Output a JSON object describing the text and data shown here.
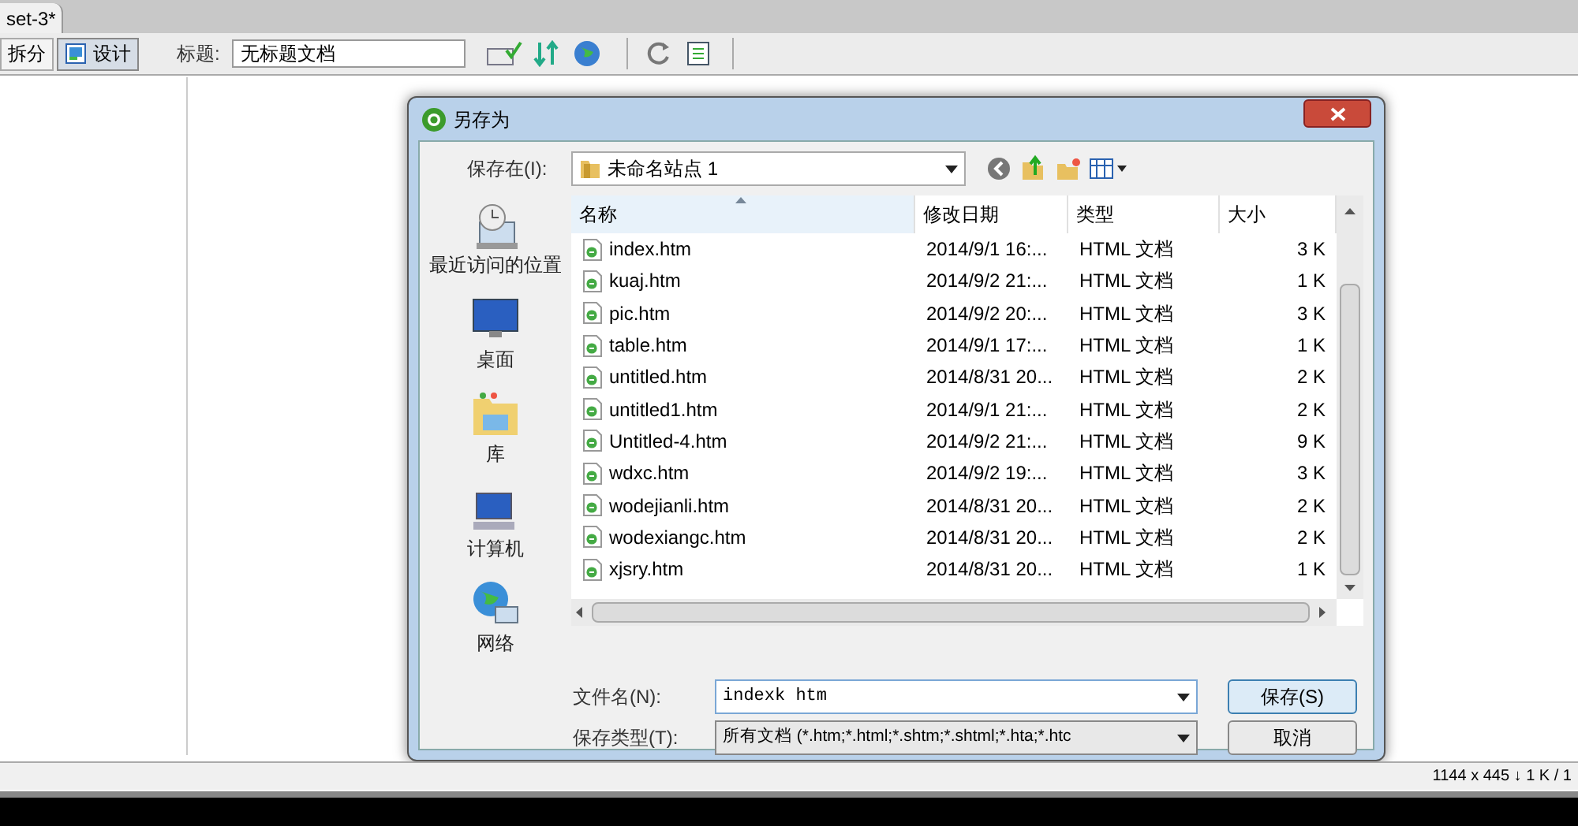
{
  "document_tab": {
    "title": "set-3*"
  },
  "toolbar": {
    "views": [
      {
        "label": "拆分",
        "selected": false
      },
      {
        "label": "设计",
        "selected": true
      }
    ],
    "title_label": "标题:",
    "title_value": "无标题文档"
  },
  "dialog": {
    "title": "另存为",
    "save_in_label": "保存在(I):",
    "save_in_value": "未命名站点 1",
    "places": [
      {
        "label": "最近访问的位置",
        "kind": "recent"
      },
      {
        "label": "桌面",
        "kind": "desktop"
      },
      {
        "label": "库",
        "kind": "library"
      },
      {
        "label": "计算机",
        "kind": "computer"
      },
      {
        "label": "网络",
        "kind": "network"
      }
    ],
    "columns": [
      "名称",
      "修改日期",
      "类型",
      "大小"
    ],
    "files": [
      {
        "name": "index.htm",
        "date": "2014/9/1 16:...",
        "type": "HTML 文档",
        "size": "3 K"
      },
      {
        "name": "kuaj.htm",
        "date": "2014/9/2 21:...",
        "type": "HTML 文档",
        "size": "1 K"
      },
      {
        "name": "pic.htm",
        "date": "2014/9/2 20:...",
        "type": "HTML 文档",
        "size": "3 K"
      },
      {
        "name": "table.htm",
        "date": "2014/9/1 17:...",
        "type": "HTML 文档",
        "size": "1 K"
      },
      {
        "name": "untitled.htm",
        "date": "2014/8/31 20...",
        "type": "HTML 文档",
        "size": "2 K"
      },
      {
        "name": "untitled1.htm",
        "date": "2014/9/1 21:...",
        "type": "HTML 文档",
        "size": "2 K"
      },
      {
        "name": "Untitled-4.htm",
        "date": "2014/9/2 21:...",
        "type": "HTML 文档",
        "size": "9 K"
      },
      {
        "name": "wdxc.htm",
        "date": "2014/9/2 19:...",
        "type": "HTML 文档",
        "size": "3 K"
      },
      {
        "name": "wodejianli.htm",
        "date": "2014/8/31 20...",
        "type": "HTML 文档",
        "size": "2 K"
      },
      {
        "name": "wodexiangc.htm",
        "date": "2014/8/31 20...",
        "type": "HTML 文档",
        "size": "2 K"
      },
      {
        "name": "xjsry.htm",
        "date": "2014/8/31 20...",
        "type": "HTML 文档",
        "size": "1 K"
      }
    ],
    "filename_label": "文件名(N):",
    "filename_value": "indexk htm",
    "filetype_label": "保存类型(T):",
    "filetype_value": "所有文档 (*.htm;*.html;*.shtm;*.shtml;*.hta;*.htc",
    "buttons": [
      "保存(S)",
      "取消"
    ]
  },
  "status_bar": {
    "text": "1144 x 445 ↓ 1 K / 1"
  }
}
